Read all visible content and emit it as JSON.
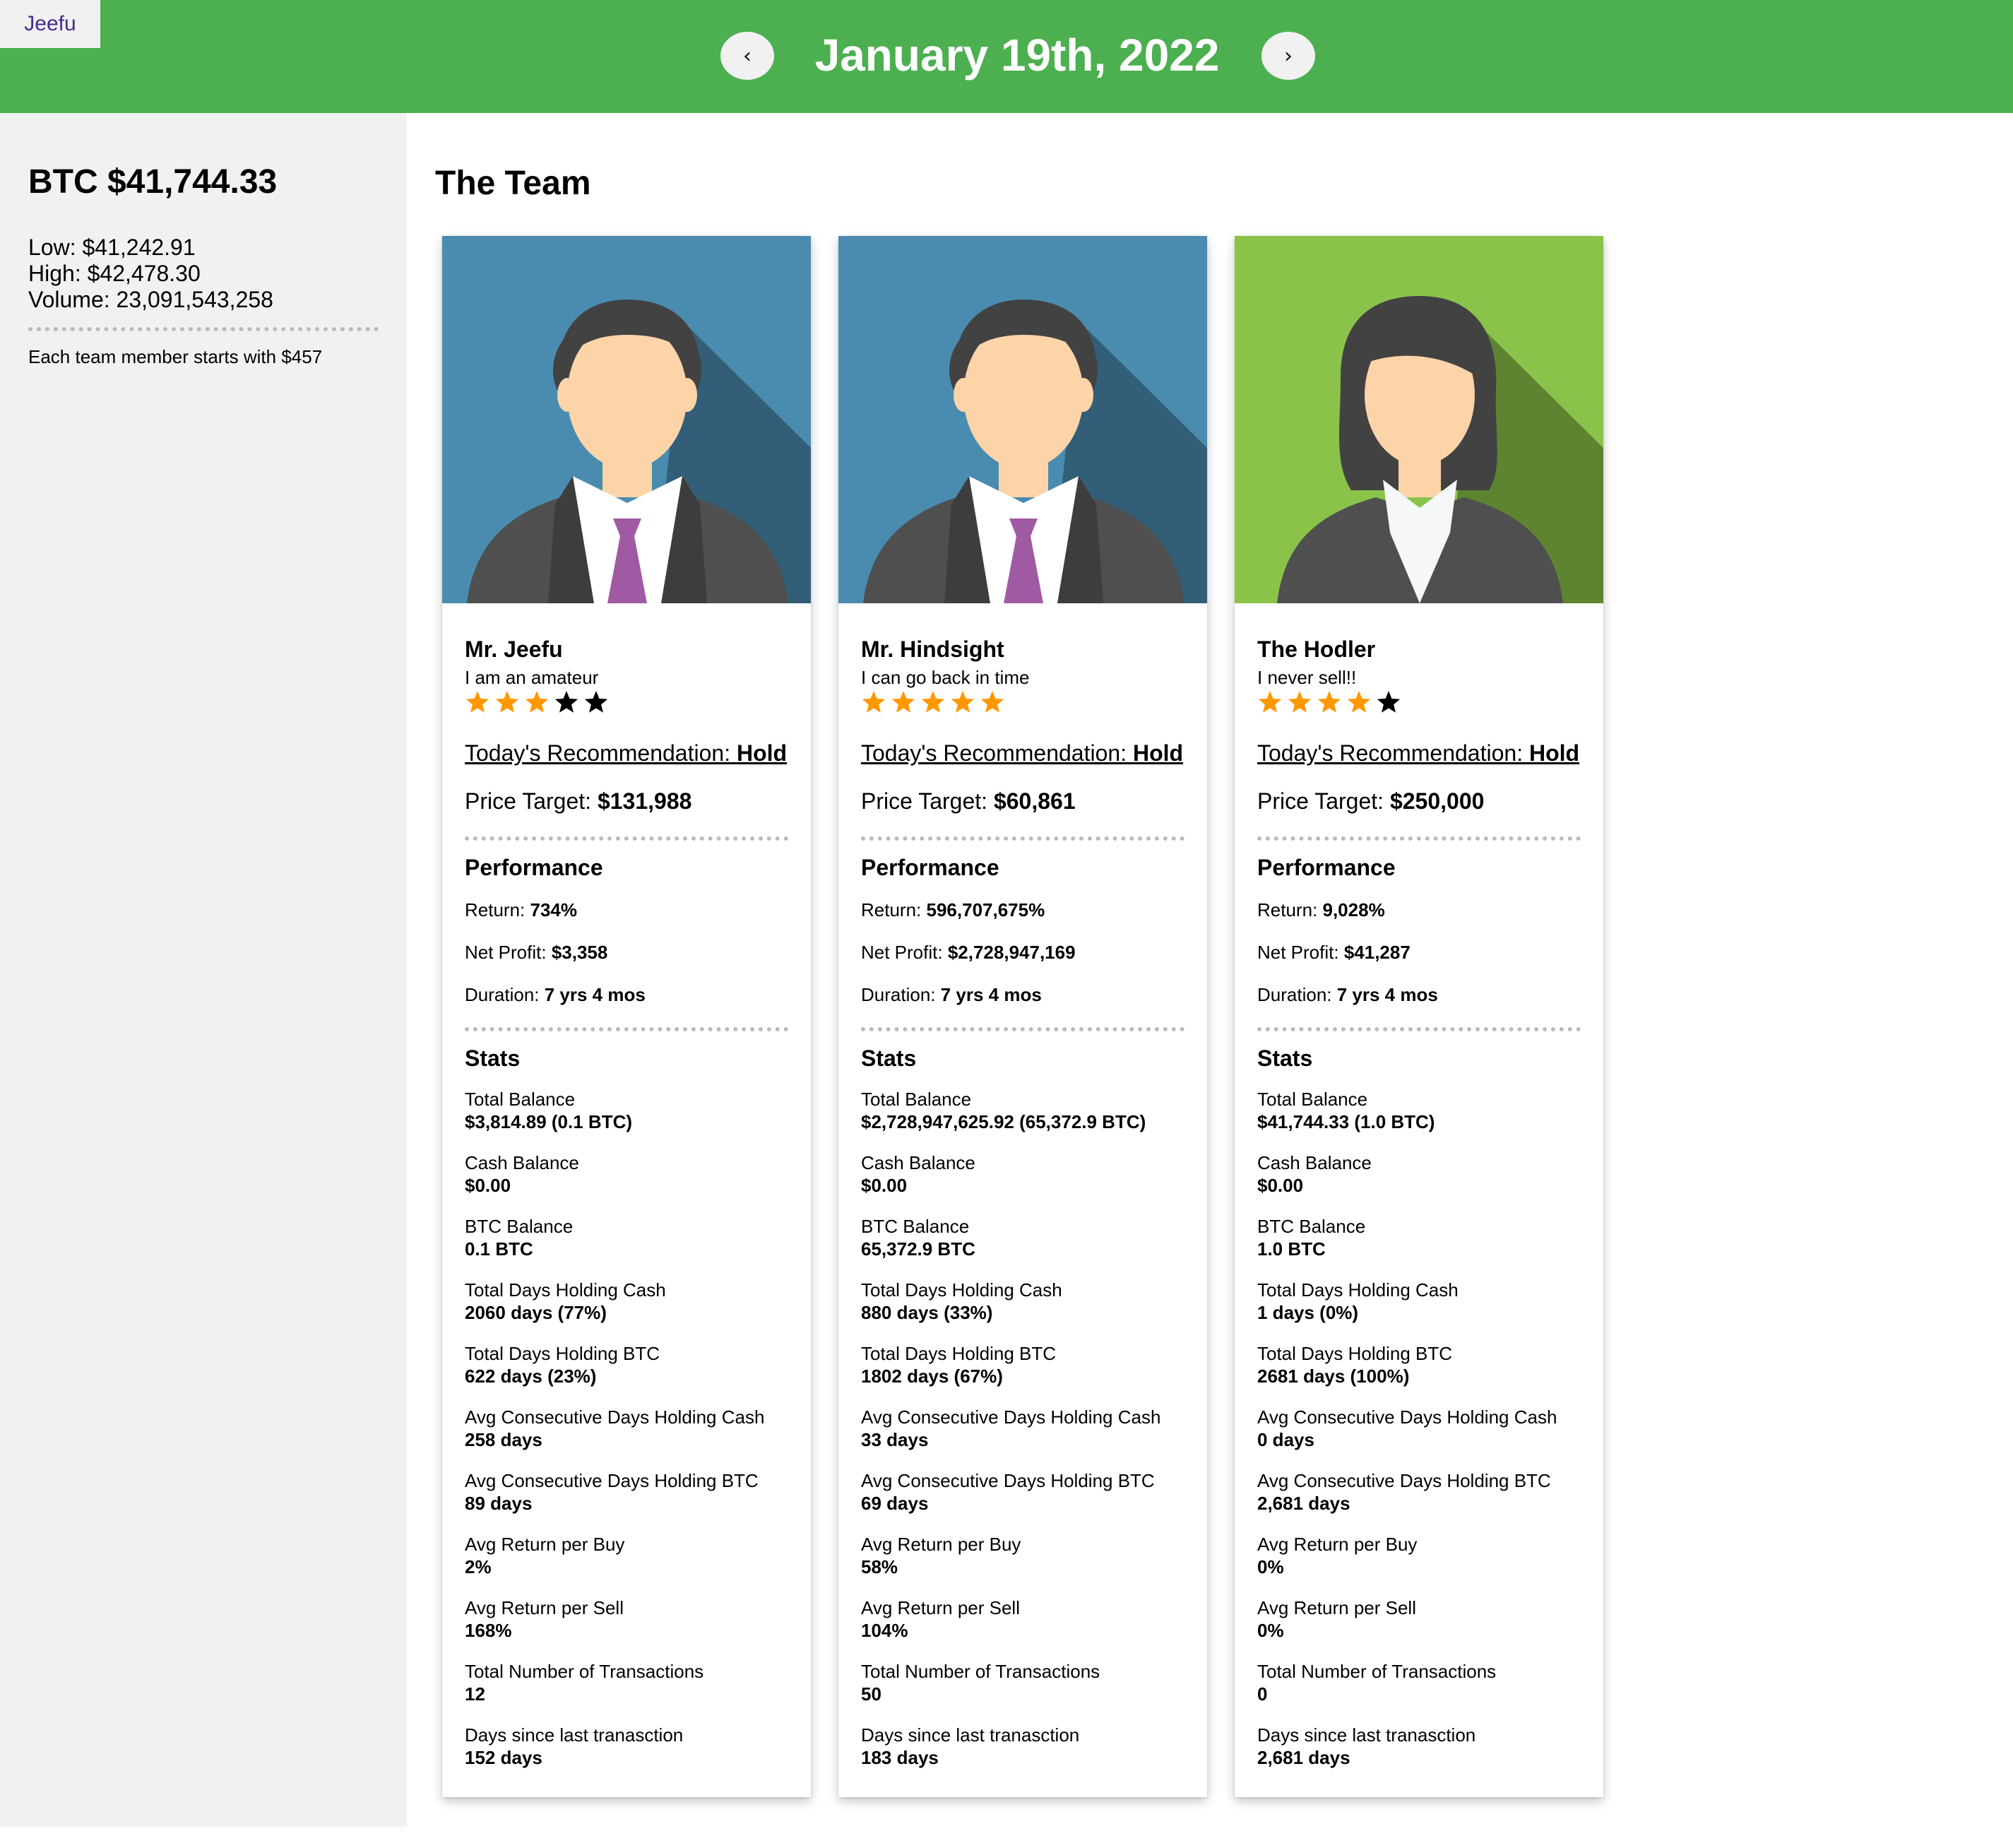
{
  "header": {
    "brand": "Jeefu",
    "prev_label": "‹",
    "next_label": "›",
    "date": "January 19th, 2022",
    "color": "#4caf50"
  },
  "sidebar": {
    "btc_price": "BTC $41,744.33",
    "low": "Low: $41,242.91",
    "high": "High: $42,478.30",
    "volume": "Volume: 23,091,543,258",
    "start_note": "Each team member starts with $457"
  },
  "main": {
    "title": "The Team",
    "members": [
      {
        "name": "Mr. Jeefu",
        "tagline": "I am an amateur",
        "rating": 3,
        "rating_max": 5,
        "avatar": "man-avatar",
        "avatar_bg": "#4a8cb0",
        "rec_label": "Today's Recommendation:",
        "rec_value": "Hold",
        "target_label": "Price Target:",
        "target_value": "$131,988",
        "performance_title": "Performance",
        "return_label": "Return:",
        "return_value": "734%",
        "profit_label": "Net Profit:",
        "profit_value": "$3,358",
        "duration_label": "Duration:",
        "duration_value": "7 yrs 4 mos",
        "stats_title": "Stats",
        "stats": [
          {
            "label": "Total Balance",
            "value": "$3,814.89 (0.1 BTC)"
          },
          {
            "label": "Cash Balance",
            "value": "$0.00"
          },
          {
            "label": "BTC Balance",
            "value": "0.1 BTC"
          },
          {
            "label": "Total Days Holding Cash",
            "value": "2060 days (77%)"
          },
          {
            "label": "Total Days Holding BTC",
            "value": "622 days (23%)"
          },
          {
            "label": "Avg Consecutive Days Holding Cash",
            "value": "258 days"
          },
          {
            "label": "Avg Consecutive Days Holding BTC",
            "value": "89 days"
          },
          {
            "label": "Avg Return per Buy",
            "value": "2%"
          },
          {
            "label": "Avg Return per Sell",
            "value": "168%"
          },
          {
            "label": "Total Number of Transactions",
            "value": "12"
          },
          {
            "label": "Days since last tranasction",
            "value": "152 days"
          }
        ]
      },
      {
        "name": "Mr. Hindsight",
        "tagline": "I can go back in time",
        "rating": 5,
        "rating_max": 5,
        "avatar": "man-avatar",
        "avatar_bg": "#4a8cb0",
        "rec_label": "Today's Recommendation:",
        "rec_value": "Hold",
        "target_label": "Price Target:",
        "target_value": "$60,861",
        "performance_title": "Performance",
        "return_label": "Return:",
        "return_value": "596,707,675%",
        "profit_label": "Net Profit:",
        "profit_value": "$2,728,947,169",
        "duration_label": "Duration:",
        "duration_value": "7 yrs 4 mos",
        "stats_title": "Stats",
        "stats": [
          {
            "label": "Total Balance",
            "value": "$2,728,947,625.92 (65,372.9 BTC)"
          },
          {
            "label": "Cash Balance",
            "value": "$0.00"
          },
          {
            "label": "BTC Balance",
            "value": "65,372.9 BTC"
          },
          {
            "label": "Total Days Holding Cash",
            "value": "880 days (33%)"
          },
          {
            "label": "Total Days Holding BTC",
            "value": "1802 days (67%)"
          },
          {
            "label": "Avg Consecutive Days Holding Cash",
            "value": "33 days"
          },
          {
            "label": "Avg Consecutive Days Holding BTC",
            "value": "69 days"
          },
          {
            "label": "Avg Return per Buy",
            "value": "58%"
          },
          {
            "label": "Avg Return per Sell",
            "value": "104%"
          },
          {
            "label": "Total Number of Transactions",
            "value": "50"
          },
          {
            "label": "Days since last tranasction",
            "value": "183 days"
          }
        ]
      },
      {
        "name": "The Hodler",
        "tagline": "I never sell!!",
        "rating": 4,
        "rating_max": 5,
        "avatar": "woman-avatar",
        "avatar_bg": "#8bc34a",
        "rec_label": "Today's Recommendation:",
        "rec_value": "Hold",
        "target_label": "Price Target:",
        "target_value": "$250,000",
        "performance_title": "Performance",
        "return_label": "Return:",
        "return_value": "9,028%",
        "profit_label": "Net Profit:",
        "profit_value": "$41,287",
        "duration_label": "Duration:",
        "duration_value": "7 yrs 4 mos",
        "stats_title": "Stats",
        "stats": [
          {
            "label": "Total Balance",
            "value": "$41,744.33 (1.0 BTC)"
          },
          {
            "label": "Cash Balance",
            "value": "$0.00"
          },
          {
            "label": "BTC Balance",
            "value": "1.0 BTC"
          },
          {
            "label": "Total Days Holding Cash",
            "value": "1 days (0%)"
          },
          {
            "label": "Total Days Holding BTC",
            "value": "2681 days (100%)"
          },
          {
            "label": "Avg Consecutive Days Holding Cash",
            "value": "0 days"
          },
          {
            "label": "Avg Consecutive Days Holding BTC",
            "value": "2,681 days"
          },
          {
            "label": "Avg Return per Buy",
            "value": "0%"
          },
          {
            "label": "Avg Return per Sell",
            "value": "0%"
          },
          {
            "label": "Total Number of Transactions",
            "value": "0"
          },
          {
            "label": "Days since last tranasction",
            "value": "2,681 days"
          }
        ]
      }
    ]
  },
  "colors": {
    "star_filled": "#ff9800",
    "star_empty": "#000000",
    "suit": "#4f4f4f",
    "skin": "#fdd4a8",
    "hair": "#424242",
    "tie": "#a05aa4"
  }
}
